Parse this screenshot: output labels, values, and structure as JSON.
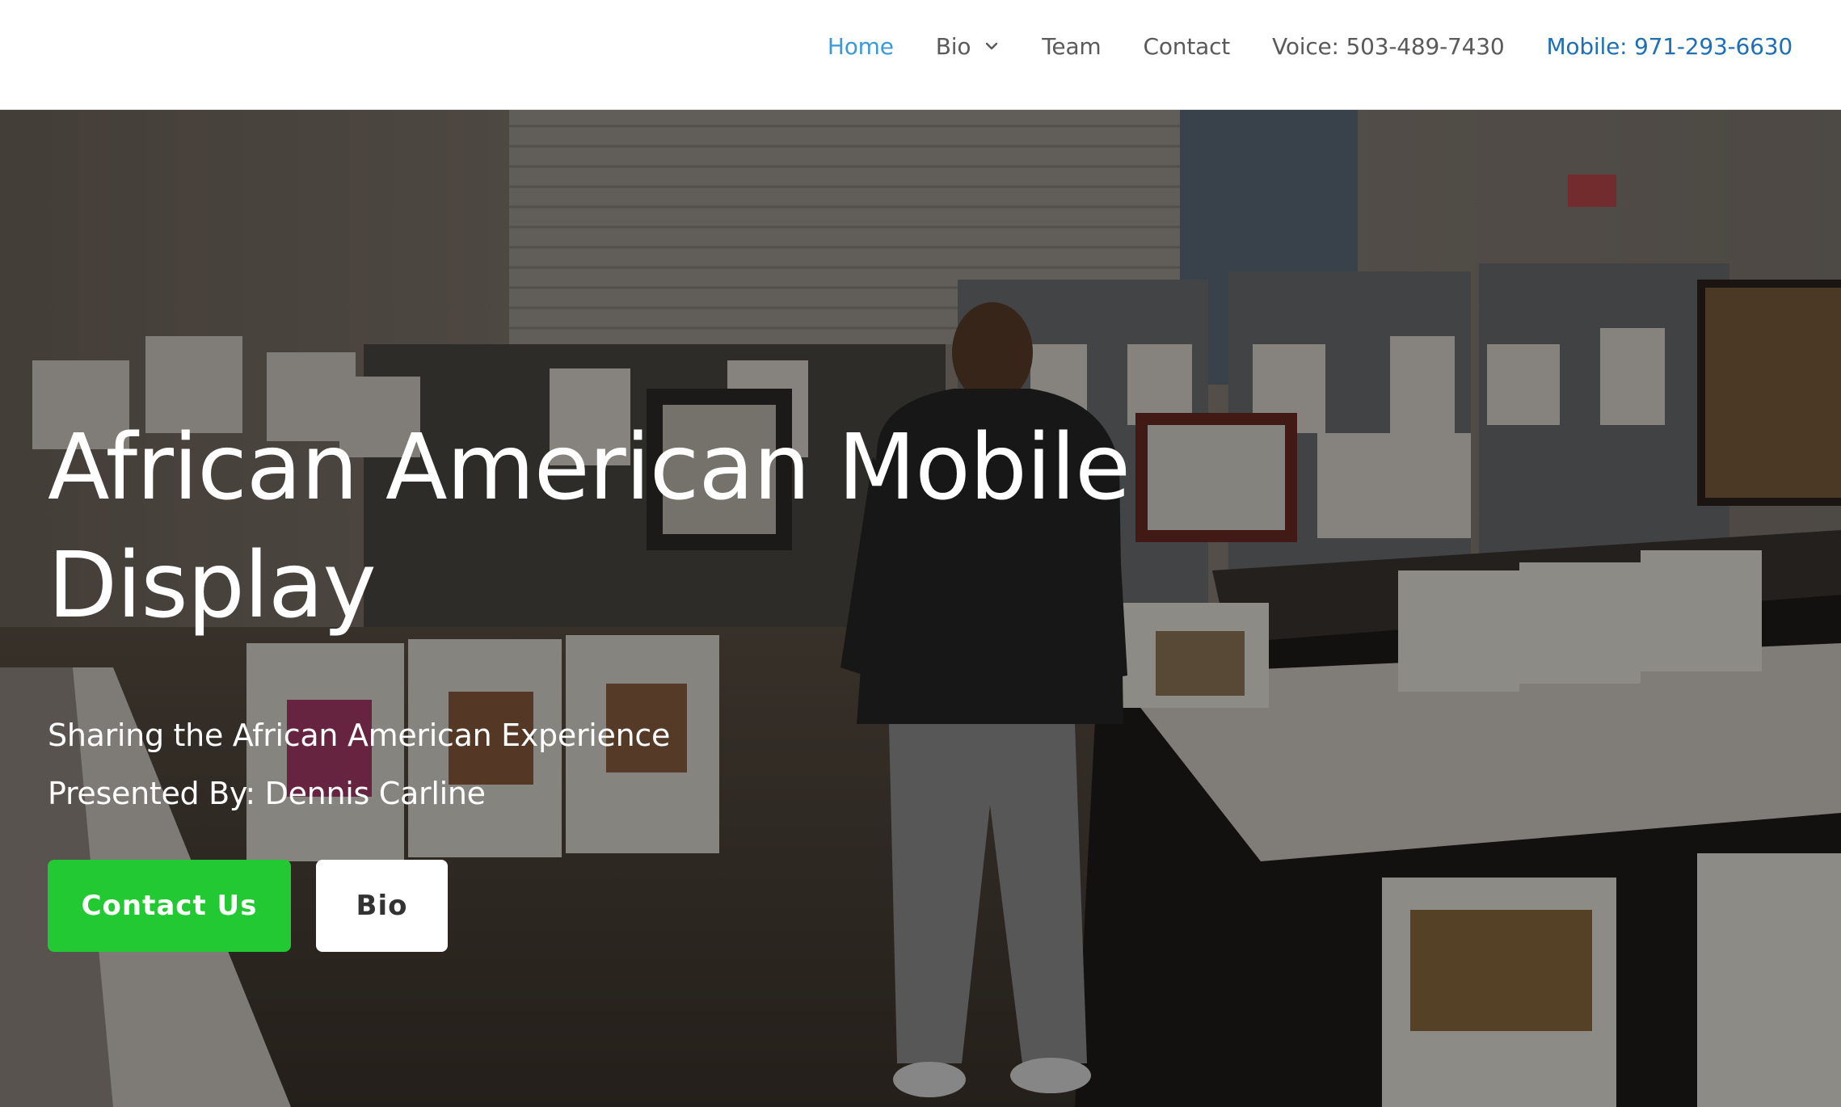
{
  "nav": {
    "items": [
      {
        "label": "Home"
      },
      {
        "label": "Bio"
      },
      {
        "label": "Team"
      },
      {
        "label": "Contact"
      },
      {
        "label": "Voice: 503-489-7430"
      },
      {
        "label": "Mobile: 971-293-6630"
      }
    ],
    "active": "Home",
    "icons": {
      "bio_dropdown": "chevron-down-icon"
    }
  },
  "hero": {
    "title": "African American Mobile Display",
    "subtitle": "Sharing the African American Experience",
    "presenter": "Presented By: Dennis Carline",
    "buttons": {
      "contact_label": "Contact Us",
      "bio_label": "Bio"
    }
  },
  "colors": {
    "nav_active": "#3a9ad9",
    "nav_mobile": "#1f6fb5",
    "nav_text": "#5a5a5a",
    "contact_button": "#22c932",
    "bio_button": "#ffffff"
  }
}
